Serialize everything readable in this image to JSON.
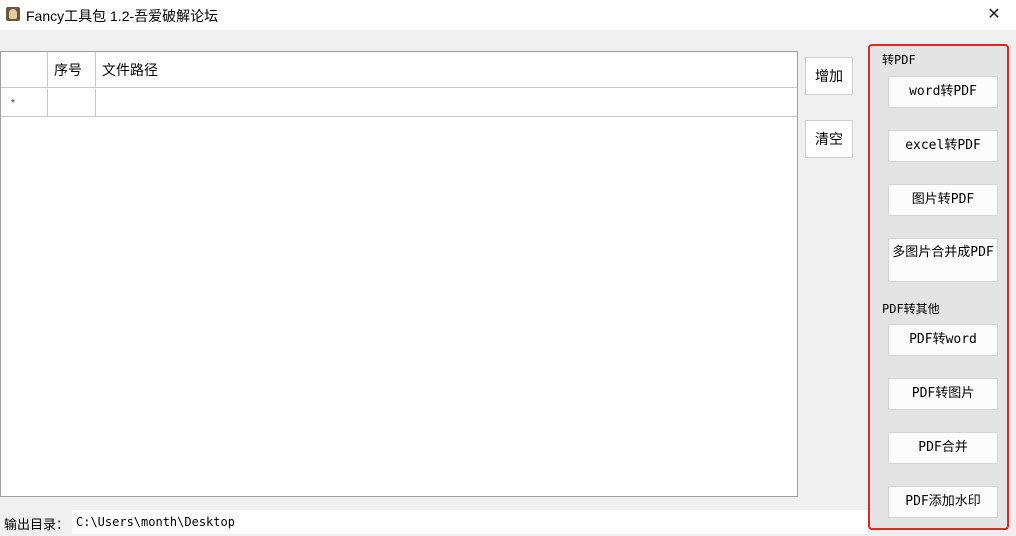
{
  "window": {
    "title": "Fancy工具包 1.2-吾爱破解论坛",
    "close_glyph": "✕"
  },
  "grid": {
    "columns": [
      "",
      "序号",
      "文件路径"
    ],
    "new_row_marker": "*"
  },
  "side_buttons": {
    "add": "增加",
    "clear": "清空"
  },
  "panel": {
    "group_to_pdf": "转PDF",
    "word_to_pdf": "word转PDF",
    "excel_to_pdf": "excel转PDF",
    "image_to_pdf": "图片转PDF",
    "multi_image_to_pdf": "多图片合并成PDF",
    "group_pdf_to_other": "PDF转其他",
    "pdf_to_word": "PDF转word",
    "pdf_to_image": "PDF转图片",
    "pdf_merge": "PDF合并",
    "pdf_watermark": "PDF添加水印"
  },
  "output": {
    "label": "输出目录：",
    "value": "C:\\Users\\month\\Desktop"
  },
  "colors": {
    "highlight_border": "#e22525",
    "client_bg": "#f0f0f0"
  }
}
